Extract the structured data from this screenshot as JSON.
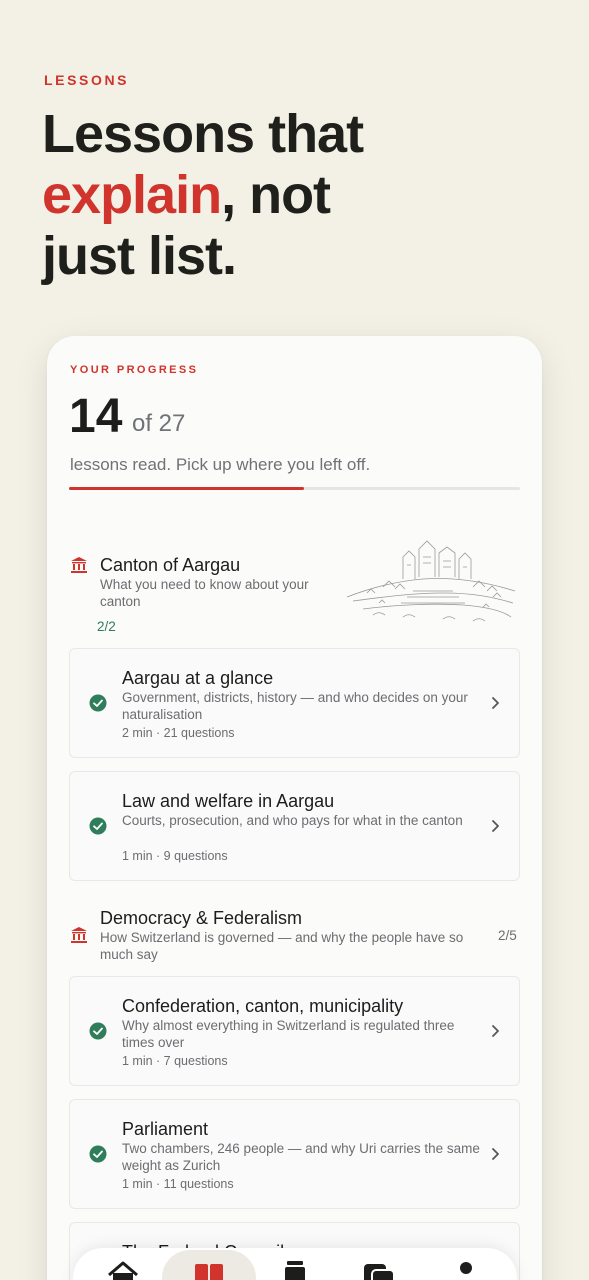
{
  "page": {
    "eyebrow": "LESSONS",
    "headline": {
      "line1": "Lessons that",
      "accent": "explain",
      "line2_rest": ", not",
      "line3": "just list."
    }
  },
  "progress": {
    "label": "YOUR PROGRESS",
    "read": "14",
    "total": "of 27",
    "subtitle": "lessons read. Pick up where you left off.",
    "fraction": 0.52
  },
  "sections": [
    {
      "title": "Canton of Aargau",
      "description": "What you need to know about your canton",
      "count": "2/2",
      "lessons": [
        {
          "title": "Aargau at a glance",
          "description": "Government, districts, history — and who decides on your naturalisation",
          "meta": "2 min · 21 questions",
          "completed": true
        },
        {
          "title": "Law and welfare in Aargau",
          "description": "Courts, prosecution, and who pays for what in the canton",
          "meta": "1 min · 9 questions",
          "completed": true
        }
      ]
    },
    {
      "title": "Democracy & Federalism",
      "description": "How Switzerland is governed — and why the people have so much say",
      "count": "2/5",
      "lessons": [
        {
          "title": "Confederation, canton, municipality",
          "description": "Why almost everything in Switzerland is regulated three times over",
          "meta": "1 min · 7 questions",
          "completed": true
        },
        {
          "title": "Parliament",
          "description": "Two chambers, 246 people — and why Uri carries the same weight as Zurich",
          "meta": "1 min · 11 questions",
          "completed": true
        },
        {
          "title": "The Federal Council",
          "description": "",
          "meta": "",
          "completed": false
        }
      ]
    }
  ],
  "tabbar": {
    "items": [
      {
        "icon": "home-icon"
      },
      {
        "icon": "book-icon",
        "active": true
      },
      {
        "icon": "document-icon"
      },
      {
        "icon": "cards-icon"
      },
      {
        "icon": "person-icon"
      }
    ]
  },
  "colors": {
    "accent": "#d0342c",
    "success": "#2f7d5a",
    "background": "#f3f1e6"
  }
}
